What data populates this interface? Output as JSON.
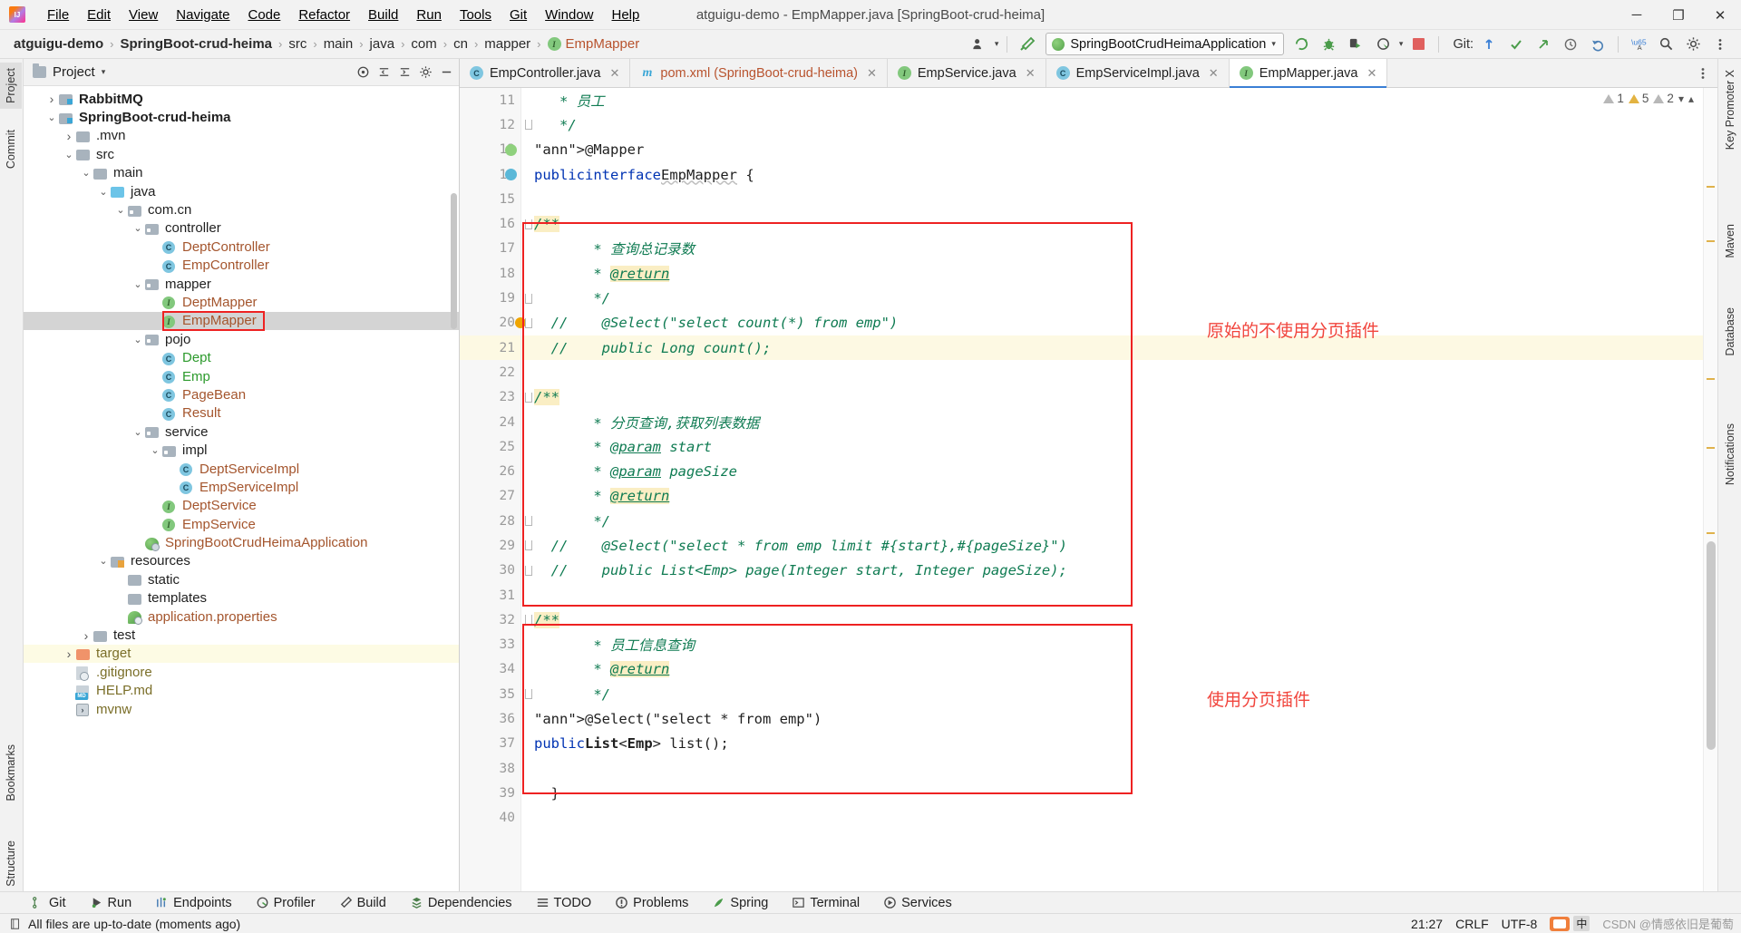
{
  "window": {
    "title": "atguigu-demo - EmpMapper.java [SpringBoot-crud-heima]",
    "minimize": "─",
    "maximize": "❐",
    "close": "✕"
  },
  "menu": [
    {
      "label": "File"
    },
    {
      "label": "Edit"
    },
    {
      "label": "View"
    },
    {
      "label": "Navigate"
    },
    {
      "label": "Code"
    },
    {
      "label": "Refactor"
    },
    {
      "label": "Build"
    },
    {
      "label": "Run"
    },
    {
      "label": "Tools"
    },
    {
      "label": "Git"
    },
    {
      "label": "Window"
    },
    {
      "label": "Help"
    }
  ],
  "breadcrumb": {
    "items": [
      {
        "label": "atguigu-demo",
        "bold": true
      },
      {
        "label": "SpringBoot-crud-heima",
        "bold": true
      },
      {
        "label": "src",
        "bold": false
      },
      {
        "label": "main",
        "bold": false
      },
      {
        "label": "java",
        "bold": false
      },
      {
        "label": "com",
        "bold": false
      },
      {
        "label": "cn",
        "bold": false
      },
      {
        "label": "mapper",
        "bold": false
      }
    ],
    "file": "EmpMapper",
    "file_icon": "interface-icon",
    "separator": "›"
  },
  "toolbar": {
    "run_configuration": "SpringBootCrudHeimaApplication",
    "git_label": "Git:",
    "dropdown_caret": "▾"
  },
  "project_panel": {
    "title": "Project",
    "dropdown_caret": "▾",
    "tree": [
      {
        "indent": 1,
        "arrow": "›",
        "icon": "module-folder-icon",
        "label": "RabbitMQ",
        "style": "bold",
        "color": "dark"
      },
      {
        "indent": 1,
        "arrow": "⌄",
        "icon": "module-folder-icon",
        "label": "SpringBoot-crud-heima",
        "style": "bold",
        "color": "dark"
      },
      {
        "indent": 2,
        "arrow": "›",
        "icon": "folder-icon",
        "label": ".mvn",
        "style": "",
        "color": "dark"
      },
      {
        "indent": 2,
        "arrow": "⌄",
        "icon": "folder-icon",
        "label": "src",
        "style": "",
        "color": "dark"
      },
      {
        "indent": 3,
        "arrow": "⌄",
        "icon": "folder-icon",
        "label": "main",
        "style": "",
        "color": "dark"
      },
      {
        "indent": 4,
        "arrow": "⌄",
        "icon": "source-folder-icon",
        "label": "java",
        "style": "",
        "color": "dark"
      },
      {
        "indent": 5,
        "arrow": "⌄",
        "icon": "package-icon",
        "label": "com.cn",
        "style": "",
        "color": "dark"
      },
      {
        "indent": 6,
        "arrow": "⌄",
        "icon": "package-icon",
        "label": "controller",
        "style": "",
        "color": "dark"
      },
      {
        "indent": 7,
        "arrow": "",
        "icon": "class-icon",
        "label": "DeptController",
        "style": "",
        "color": "orange"
      },
      {
        "indent": 7,
        "arrow": "",
        "icon": "class-icon",
        "label": "EmpController",
        "style": "",
        "color": "orange"
      },
      {
        "indent": 6,
        "arrow": "⌄",
        "icon": "package-icon",
        "label": "mapper",
        "style": "",
        "color": "dark"
      },
      {
        "indent": 7,
        "arrow": "",
        "icon": "interface-icon",
        "label": "DeptMapper",
        "style": "",
        "color": "orange"
      },
      {
        "indent": 7,
        "arrow": "",
        "icon": "interface-icon",
        "label": "EmpMapper",
        "style": "",
        "color": "orange",
        "selected": true,
        "highlight_box": true
      },
      {
        "indent": 6,
        "arrow": "⌄",
        "icon": "package-icon",
        "label": "pojo",
        "style": "",
        "color": "dark"
      },
      {
        "indent": 7,
        "arrow": "",
        "icon": "class-icon",
        "label": "Dept",
        "style": "",
        "color": "green"
      },
      {
        "indent": 7,
        "arrow": "",
        "icon": "class-icon",
        "label": "Emp",
        "style": "",
        "color": "green"
      },
      {
        "indent": 7,
        "arrow": "",
        "icon": "class-icon",
        "label": "PageBean",
        "style": "",
        "color": "orange"
      },
      {
        "indent": 7,
        "arrow": "",
        "icon": "class-icon",
        "label": "Result",
        "style": "",
        "color": "orange"
      },
      {
        "indent": 6,
        "arrow": "⌄",
        "icon": "package-icon",
        "label": "service",
        "style": "",
        "color": "dark"
      },
      {
        "indent": 7,
        "arrow": "⌄",
        "icon": "package-icon",
        "label": "impl",
        "style": "",
        "color": "dark"
      },
      {
        "indent": 8,
        "arrow": "",
        "icon": "class-icon",
        "label": "DeptServiceImpl",
        "style": "",
        "color": "orange"
      },
      {
        "indent": 8,
        "arrow": "",
        "icon": "class-icon",
        "label": "EmpServiceImpl",
        "style": "",
        "color": "orange"
      },
      {
        "indent": 7,
        "arrow": "",
        "icon": "interface-icon",
        "label": "DeptService",
        "style": "",
        "color": "orange"
      },
      {
        "indent": 7,
        "arrow": "",
        "icon": "interface-icon",
        "label": "EmpService",
        "style": "",
        "color": "orange"
      },
      {
        "indent": 6,
        "arrow": "",
        "icon": "spring-class-icon",
        "label": "SpringBootCrudHeimaApplication",
        "style": "",
        "color": "orange"
      },
      {
        "indent": 4,
        "arrow": "⌄",
        "icon": "resources-folder-icon",
        "label": "resources",
        "style": "",
        "color": "dark"
      },
      {
        "indent": 5,
        "arrow": "",
        "icon": "folder-icon",
        "label": "static",
        "style": "",
        "color": "dark"
      },
      {
        "indent": 5,
        "arrow": "",
        "icon": "folder-icon",
        "label": "templates",
        "style": "",
        "color": "dark"
      },
      {
        "indent": 5,
        "arrow": "",
        "icon": "spring-properties-icon",
        "label": "application.properties",
        "style": "",
        "color": "orange"
      },
      {
        "indent": 3,
        "arrow": "›",
        "icon": "folder-icon",
        "label": "test",
        "style": "",
        "color": "dark"
      },
      {
        "indent": 2,
        "arrow": "›",
        "icon": "target-folder-icon",
        "label": "target",
        "style": "",
        "color": "olive",
        "target_row": true
      },
      {
        "indent": 2,
        "arrow": "",
        "icon": "gitignore-file-icon",
        "label": ".gitignore",
        "style": "",
        "color": "olive"
      },
      {
        "indent": 2,
        "arrow": "",
        "icon": "markdown-file-icon",
        "label": "HELP.md",
        "style": "",
        "color": "olive"
      },
      {
        "indent": 2,
        "arrow": "",
        "icon": "shell-file-icon",
        "label": "mvnw",
        "style": "",
        "color": "olive"
      }
    ]
  },
  "left_strip": [
    {
      "label": "Project",
      "active": true
    },
    {
      "label": "Commit",
      "active": false
    },
    {
      "label": "Bookmarks",
      "active": false
    },
    {
      "label": "Structure",
      "active": false
    }
  ],
  "right_strip": [
    {
      "label": "Key Promoter X"
    },
    {
      "label": "Maven"
    },
    {
      "label": "Database"
    },
    {
      "label": "Notifications"
    }
  ],
  "editor_tabs": [
    {
      "label": "EmpController.java",
      "icon": "class-icon",
      "active": false,
      "close": "✕"
    },
    {
      "label": "pom.xml (SpringBoot-crud-heima)",
      "icon": "maven-icon",
      "active": false,
      "close": "✕"
    },
    {
      "label": "EmpService.java",
      "icon": "interface-icon",
      "active": false,
      "close": "✕"
    },
    {
      "label": "EmpServiceImpl.java",
      "icon": "class-icon",
      "active": false,
      "close": "✕"
    },
    {
      "label": "EmpMapper.java",
      "icon": "interface-icon",
      "active": true,
      "close": "✕"
    }
  ],
  "inspection": {
    "error_count": "1",
    "warning_count": "5",
    "weak_warning_count": "2",
    "error_icon": "triangle-warning-icon",
    "warning_icon": "triangle-warning-icon",
    "weak_icon": "triangle-warning-icon"
  },
  "code": {
    "first_line_number": 11,
    "lines": [
      {
        "n": 11,
        "text": "   * 员工"
      },
      {
        "n": 12,
        "text": "   */"
      },
      {
        "n": 13,
        "text": "  @Mapper"
      },
      {
        "n": 14,
        "text": "  public interface EmpMapper {"
      },
      {
        "n": 15,
        "text": ""
      },
      {
        "n": 16,
        "text": "      /**"
      },
      {
        "n": 17,
        "text": "       * 查询总记录数"
      },
      {
        "n": 18,
        "text": "       * @return"
      },
      {
        "n": 19,
        "text": "       */"
      },
      {
        "n": 20,
        "text": "  //    @Select(\"select count(*) from emp\")"
      },
      {
        "n": 21,
        "text": "  //    public Long count();"
      },
      {
        "n": 22,
        "text": ""
      },
      {
        "n": 23,
        "text": "      /**"
      },
      {
        "n": 24,
        "text": "       * 分页查询,获取列表数据"
      },
      {
        "n": 25,
        "text": "       * @param start"
      },
      {
        "n": 26,
        "text": "       * @param pageSize"
      },
      {
        "n": 27,
        "text": "       * @return"
      },
      {
        "n": 28,
        "text": "       */"
      },
      {
        "n": 29,
        "text": "  //    @Select(\"select * from emp limit #{start},#{pageSize}\")"
      },
      {
        "n": 30,
        "text": "  //    public List<Emp> page(Integer start, Integer pageSize);"
      },
      {
        "n": 31,
        "text": ""
      },
      {
        "n": 32,
        "text": "      /**"
      },
      {
        "n": 33,
        "text": "       * 员工信息查询"
      },
      {
        "n": 34,
        "text": "       * @return"
      },
      {
        "n": 35,
        "text": "       */"
      },
      {
        "n": 36,
        "text": "      @Select(\"select * from emp\")"
      },
      {
        "n": 37,
        "text": "      public List<Emp> list();"
      },
      {
        "n": 38,
        "text": ""
      },
      {
        "n": 39,
        "text": "  }"
      },
      {
        "n": 40,
        "text": ""
      }
    ]
  },
  "annotations": {
    "top_note": "原始的不使用分页插件",
    "bottom_note": "使用分页插件",
    "color": "#f1453d"
  },
  "bottom_tools": [
    {
      "label": "Git",
      "icon": "git-branch-icon"
    },
    {
      "label": "Run",
      "icon": "run-icon"
    },
    {
      "label": "Endpoints",
      "icon": "endpoints-icon"
    },
    {
      "label": "Profiler",
      "icon": "profiler-icon"
    },
    {
      "label": "Build",
      "icon": "build-hammer-icon"
    },
    {
      "label": "Dependencies",
      "icon": "dependencies-icon"
    },
    {
      "label": "TODO",
      "icon": "todo-list-icon"
    },
    {
      "label": "Problems",
      "icon": "problems-icon"
    },
    {
      "label": "Spring",
      "icon": "spring-leaf-icon"
    },
    {
      "label": "Terminal",
      "icon": "terminal-icon"
    },
    {
      "label": "Services",
      "icon": "services-icon"
    }
  ],
  "status_bar": {
    "message": "All files are up-to-date (moments ago)",
    "message_icon": "document-icon",
    "caret_position": "21:27",
    "line_separator": "CRLF",
    "encoding": "UTF-8",
    "ime_label": "中",
    "watermark": "CSDN @情感依旧是葡萄",
    "sogou_icon": "sogou-ime-icon"
  }
}
